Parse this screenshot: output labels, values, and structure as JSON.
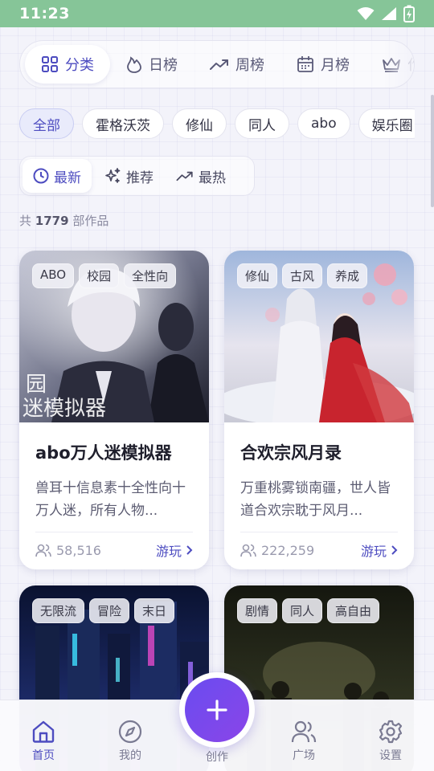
{
  "status_bar": {
    "time": "11:23"
  },
  "top_tabs": [
    {
      "label": "分类",
      "icon": "grid-icon",
      "active": true
    },
    {
      "label": "日榜",
      "icon": "flame-icon",
      "active": false
    },
    {
      "label": "周榜",
      "icon": "trending-icon",
      "active": false
    },
    {
      "label": "月榜",
      "icon": "calendar-icon",
      "active": false
    },
    {
      "label": "作",
      "icon": "crown-icon",
      "active": false
    }
  ],
  "genres": [
    "全部",
    "霍格沃茨",
    "修仙",
    "同人",
    "abo",
    "娱乐圈"
  ],
  "sort": [
    {
      "label": "最新",
      "icon": "clock-icon",
      "active": true
    },
    {
      "label": "推荐",
      "icon": "sparkle-icon",
      "active": false
    },
    {
      "label": "最热",
      "icon": "trending-icon",
      "active": false
    }
  ],
  "count": {
    "prefix": "共",
    "number": "1779",
    "suffix": "部作品"
  },
  "cards": [
    {
      "tags": [
        "ABO",
        "校园",
        "全性向"
      ],
      "title": "abo万人迷模拟器",
      "desc": "兽耳十信息素十全性向十万人迷，所有人物...",
      "plays": "58,516",
      "action": "游玩"
    },
    {
      "tags": [
        "修仙",
        "古风",
        "养成"
      ],
      "title": "合欢宗风月录",
      "desc": "万重桃雾锁南疆，世人皆道合欢宗耽于风月...",
      "plays": "222,259",
      "action": "游玩"
    },
    {
      "tags": [
        "无限流",
        "冒险",
        "末日"
      ]
    },
    {
      "tags": [
        "剧情",
        "同人",
        "高自由"
      ]
    }
  ],
  "bottom_nav": [
    {
      "label": "首页",
      "icon": "home-icon",
      "active": true
    },
    {
      "label": "我的",
      "icon": "compass-icon",
      "active": false
    },
    {
      "label": "创作",
      "icon": "plus-icon",
      "active": false
    },
    {
      "label": "广场",
      "icon": "users-icon",
      "active": false
    },
    {
      "label": "设置",
      "icon": "gear-icon",
      "active": false
    }
  ],
  "colors": {
    "accent": "#4d4cc0",
    "fab": "#7048ee",
    "status_bar": "#86c598"
  }
}
